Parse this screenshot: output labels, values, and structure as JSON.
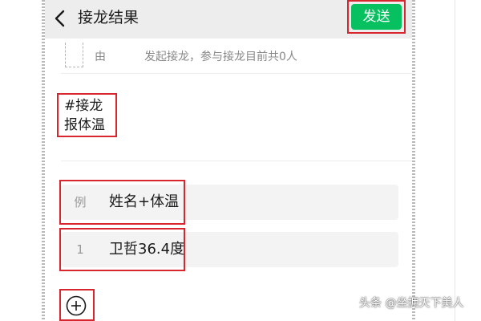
{
  "header": {
    "title": "接龙结果",
    "send_label": "发送"
  },
  "initiator": {
    "name_fragment": "由",
    "status": "发起接龙，参与接龙目前共0人"
  },
  "intro": {
    "line1": "#接龙",
    "line2": "报体温"
  },
  "entries": [
    {
      "label": "例",
      "text": "姓名+体温"
    },
    {
      "label": "1",
      "text": "卫哲36.4度"
    }
  ],
  "icons": {
    "back": "chevron-left-icon",
    "add": "plus-circle-icon"
  },
  "colors": {
    "send_button": "#07c160",
    "highlight_border": "#d8262e",
    "header_bg": "#ededed"
  },
  "watermark": "头条 @坐拥天下美人"
}
